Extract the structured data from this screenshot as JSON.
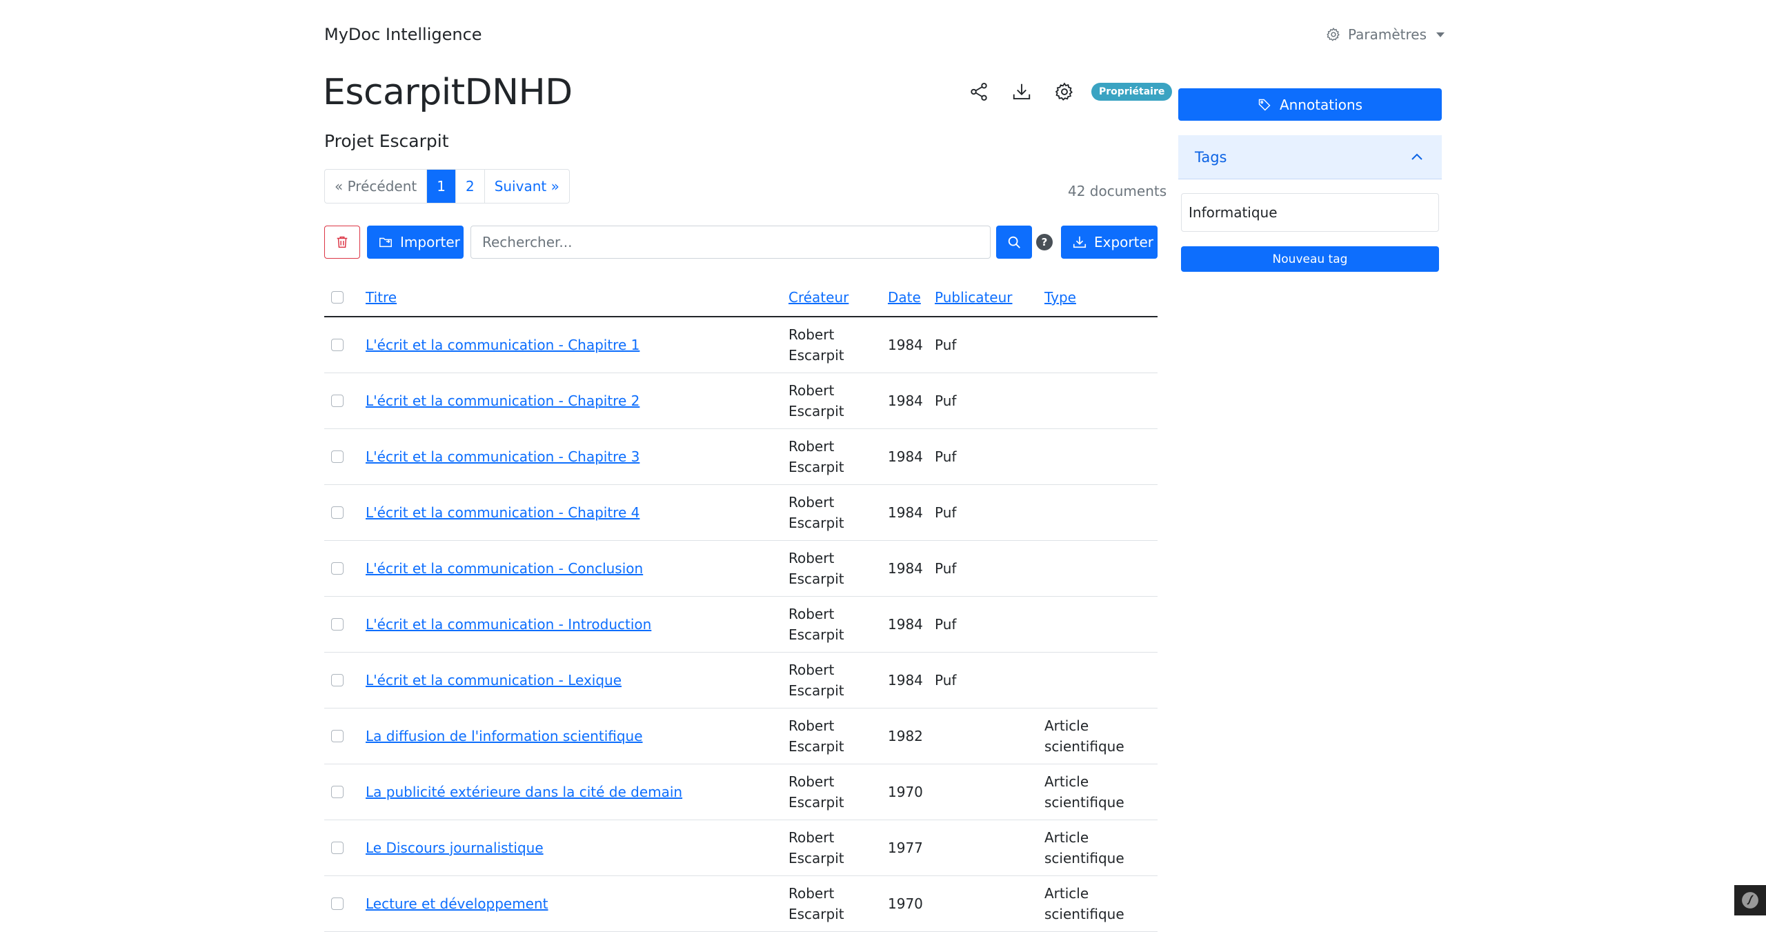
{
  "brand": "MyDoc Intelligence",
  "settings_menu": {
    "label": "Paramètres",
    "icon": "gear-icon"
  },
  "corpus": {
    "title": "EscarpitDNHD",
    "subtitle": "Projet Escarpit",
    "owner_badge": "Propriétaire"
  },
  "title_actions": [
    "share-icon",
    "download-icon",
    "gear-icon"
  ],
  "pagination": {
    "previous": "« Précédent",
    "pages": [
      "1",
      "2"
    ],
    "current_page": "1",
    "next": "Suivant »"
  },
  "document_count": "42 documents",
  "toolbar": {
    "import_label": "Importer",
    "search_placeholder": "Rechercher...",
    "help": "?",
    "export_label": "Exporter"
  },
  "table": {
    "headers": {
      "title": "Titre",
      "creator": "Créateur",
      "date": "Date",
      "publisher": "Publicateur",
      "type": "Type"
    },
    "rows": [
      {
        "title": "L'écrit et la communication - Chapitre 1",
        "creator": [
          "Robert",
          "Escarpit"
        ],
        "date": "1984",
        "publisher": "Puf",
        "type": [
          "",
          ""
        ]
      },
      {
        "title": "L'écrit et la communication - Chapitre 2",
        "creator": [
          "Robert",
          "Escarpit"
        ],
        "date": "1984",
        "publisher": "Puf",
        "type": [
          "",
          ""
        ]
      },
      {
        "title": "L'écrit et la communication - Chapitre 3",
        "creator": [
          "Robert",
          "Escarpit"
        ],
        "date": "1984",
        "publisher": "Puf",
        "type": [
          "",
          ""
        ]
      },
      {
        "title": "L'écrit et la communication - Chapitre 4",
        "creator": [
          "Robert",
          "Escarpit"
        ],
        "date": "1984",
        "publisher": "Puf",
        "type": [
          "",
          ""
        ]
      },
      {
        "title": "L'écrit et la communication - Conclusion",
        "creator": [
          "Robert",
          "Escarpit"
        ],
        "date": "1984",
        "publisher": "Puf",
        "type": [
          "",
          ""
        ]
      },
      {
        "title": "L'écrit et la communication - Introduction",
        "creator": [
          "Robert",
          "Escarpit"
        ],
        "date": "1984",
        "publisher": "Puf",
        "type": [
          "",
          ""
        ]
      },
      {
        "title": "L'écrit et la communication - Lexique",
        "creator": [
          "Robert",
          "Escarpit"
        ],
        "date": "1984",
        "publisher": "Puf",
        "type": [
          "",
          ""
        ]
      },
      {
        "title": "La diffusion de l'information scientifique",
        "creator": [
          "Robert",
          "Escarpit"
        ],
        "date": "1982",
        "publisher": "",
        "type": [
          "Article",
          "scientifique"
        ]
      },
      {
        "title": "La publicité extérieure dans la cité de demain",
        "creator": [
          "Robert",
          "Escarpit"
        ],
        "date": "1970",
        "publisher": "",
        "type": [
          "Article",
          "scientifique"
        ]
      },
      {
        "title": "Le Discours journalistique",
        "creator": [
          "Robert",
          "Escarpit"
        ],
        "date": "1977",
        "publisher": "",
        "type": [
          "Article",
          "scientifique"
        ]
      },
      {
        "title": "Lecture et développement",
        "creator": [
          "Robert",
          "Escarpit"
        ],
        "date": "1970",
        "publisher": "",
        "type": [
          "Article",
          "scientifique"
        ]
      }
    ]
  },
  "sidebar": {
    "annotations_label": "Annotations",
    "tags_title": "Tags",
    "tags": [
      "Informatique"
    ],
    "new_tag_label": "Nouveau tag"
  },
  "colors": {
    "primary": "#0d6efd",
    "danger": "#dc3545",
    "badge": "#3aa3c2",
    "accordion_bg": "#e7f1ff"
  }
}
